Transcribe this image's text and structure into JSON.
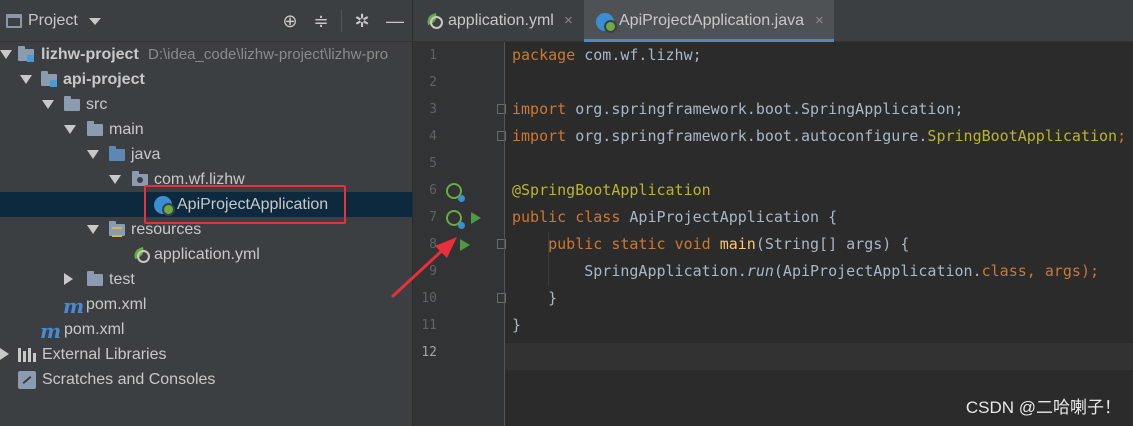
{
  "project_panel": {
    "title": "Project",
    "header_icons": [
      "locate-icon",
      "collapse-all-icon",
      "gear-icon",
      "hide-icon"
    ],
    "tree": {
      "root": {
        "label": "lizhw-project",
        "path": "D:\\idea_code\\lizhw-project\\lizhw-pro"
      },
      "module": "api-project",
      "src": "src",
      "main": "main",
      "java": "java",
      "package": "com.wf.lizhw",
      "main_class": "ApiProjectApplication",
      "resources": "resources",
      "application_yml": "application.yml",
      "test": "test",
      "module_pom": "pom.xml",
      "root_pom": "pom.xml",
      "external_libraries": "External Libraries",
      "scratches": "Scratches and Consoles"
    }
  },
  "editor": {
    "tabs": [
      {
        "label": "application.yml",
        "close": "×",
        "active": false
      },
      {
        "label": "ApiProjectApplication.java",
        "close": "×",
        "active": true
      }
    ],
    "line_numbers": [
      "1",
      "2",
      "3",
      "4",
      "5",
      "6",
      "7",
      "8",
      "9",
      "10",
      "11",
      "12"
    ],
    "current_line": 12,
    "code": {
      "line1": {
        "kw": "package",
        "rest": " com.wf.lizhw;"
      },
      "line3": {
        "kw": "import",
        "rest": " org.springframework.boot.SpringApplication;"
      },
      "line4": {
        "kw": "import",
        "rest": " org.springframework.boot.autoconfigure.",
        "ann": "SpringBootApplication",
        "end": ";"
      },
      "line6": {
        "ann": "@SpringBootApplication"
      },
      "line7": {
        "kw1": "public",
        "kw2": "class",
        "rest": " ApiProjectApplication {"
      },
      "line8": {
        "kw1": "public",
        "kw2": "static",
        "kw3": "void",
        "fn": "main",
        "rest": "(String[] args) {"
      },
      "line9": {
        "cls": "SpringApplication.",
        "call": "run",
        "open": "(ApiProjectApplication.",
        "kw": "class",
        "close": ", args);"
      },
      "line10": {
        "text": "}"
      },
      "line11": {
        "text": "}"
      }
    }
  },
  "watermark": "CSDN @二哈喇子！",
  "colors": {
    "panel_bg": "#3c3f41",
    "editor_bg": "#2b2b2b",
    "selection": "#0d293e",
    "highlight_box": "#e8303a",
    "keyword": "#cc7832",
    "annotation": "#bbb529",
    "function": "#ffc66d"
  }
}
